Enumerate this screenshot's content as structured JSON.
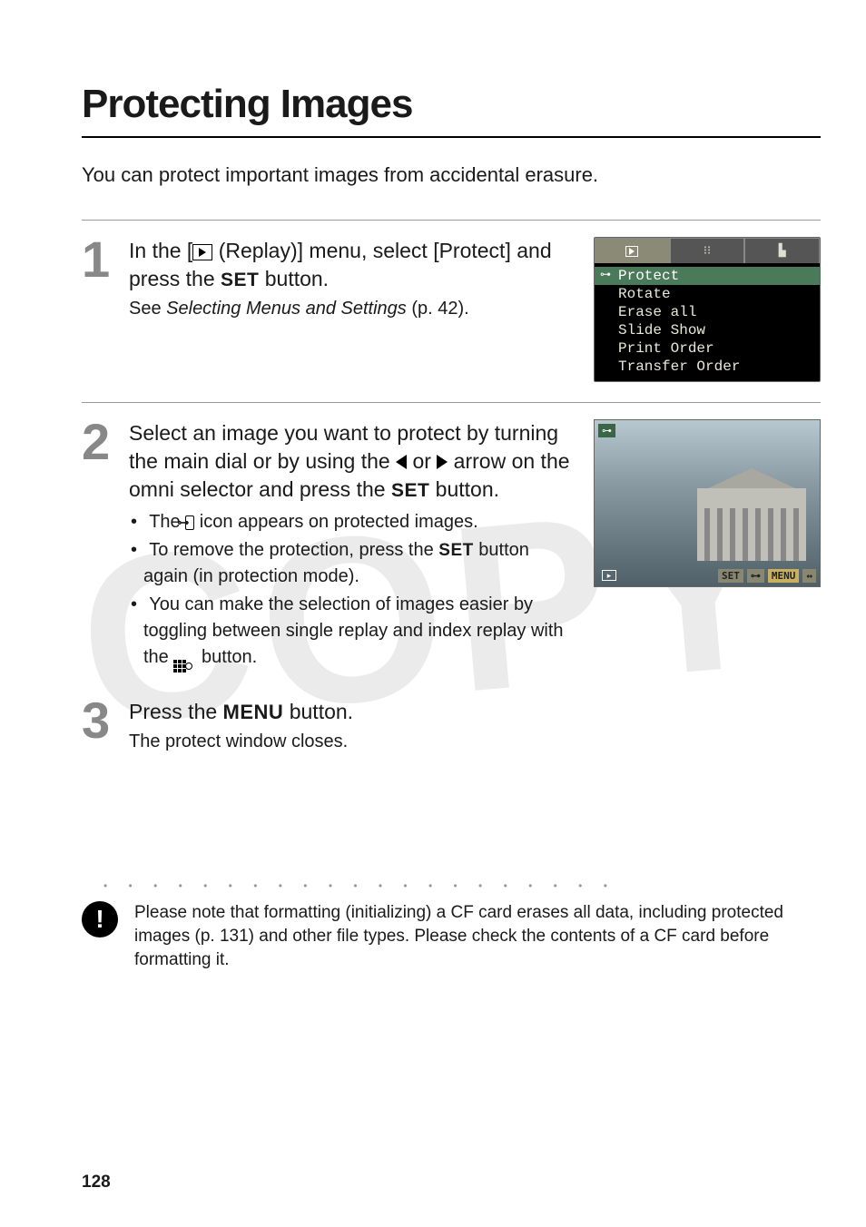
{
  "title": "Protecting Images",
  "intro": "You can protect important images from accidental erasure.",
  "steps": [
    {
      "num": "1",
      "heading_parts": {
        "pre": "In the [",
        "mid": " (Replay)] menu, select [Protect] and press the ",
        "set": "SET",
        "post": " button."
      },
      "sub_pre": "See ",
      "sub_italic": "Selecting Menus and Settings",
      "sub_post": " (p. 42).",
      "menu_items": [
        "Protect",
        "Rotate",
        "Erase all",
        "Slide Show",
        "Print Order",
        "Transfer Order"
      ]
    },
    {
      "num": "2",
      "heading_parts": {
        "a": "Select an image you want to protect by turning the main dial or by using the ",
        "b": " or ",
        "c": " arrow on the omni selector and press the ",
        "set": "SET",
        "d": " button."
      },
      "bullets": [
        {
          "pre": "The ",
          "icon": "key",
          "post": " icon appears on protected images."
        },
        {
          "pre": "To remove the protection, press the ",
          "set": "SET",
          "post": " button again (in protection mode)."
        },
        {
          "pre": "You can make the selection of images easier by toggling between single replay and index replay with the ",
          "icon": "index",
          "post": " button."
        }
      ],
      "photo_badges": {
        "tl": "⊶",
        "set": "SET",
        "key": "⊶",
        "menu": "MENU",
        "arrows": "↔"
      }
    },
    {
      "num": "3",
      "heading_parts": {
        "pre": "Press the ",
        "menu": "MENU",
        "post": " button."
      },
      "sub": "The protect window closes."
    }
  ],
  "dots": "•  •  •  •  •  •  •  •  •  •  •  •  •  •  •  •  •  •  •  •  •",
  "warning": "Please note that formatting (initializing) a CF card erases all data, including protected images (p. 131) and other file types. Please check the contents of a CF card before formatting it.",
  "page_number": "128"
}
